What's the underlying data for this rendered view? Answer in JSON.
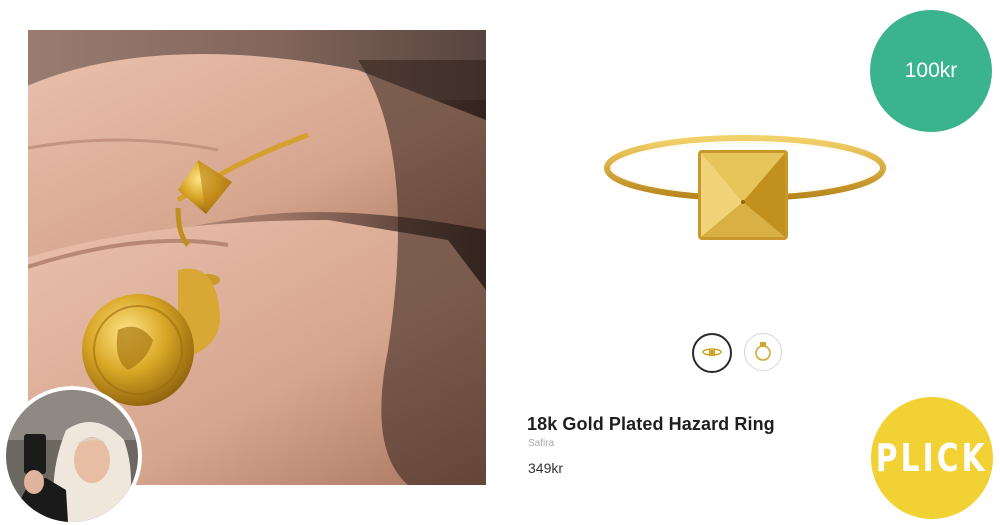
{
  "lifestyle_photo": {
    "subject": "hand-wearing-rings"
  },
  "avatar": {
    "subject": "seller-avatar"
  },
  "product": {
    "title": "18k Gold Plated Hazard Ring",
    "brand": "Safira",
    "price": "349kr"
  },
  "thumbnails": [
    {
      "name": "thumb-ring-side",
      "selected": true
    },
    {
      "name": "thumb-ring-top",
      "selected": false
    }
  ],
  "price_badge": {
    "label": "100kr",
    "color": "#3bb38d"
  },
  "plick_button": {
    "label": "PLICK",
    "color": "#f2d134"
  }
}
